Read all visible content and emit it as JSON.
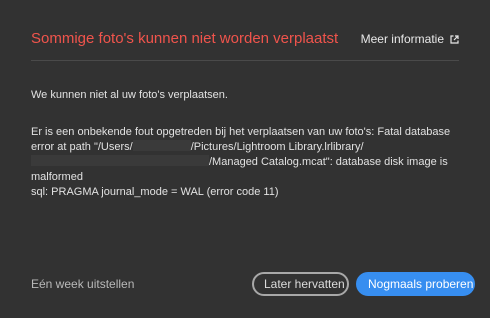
{
  "dialog": {
    "title": "Sommige foto's kunnen niet worden verplaatst",
    "more_info_label": "Meer informatie",
    "more_info_icon": "external-link-icon",
    "intro": "We kunnen niet al uw foto's verplaatsen.",
    "error_lines": {
      "line1": "Er is een onbekende fout opgetreden bij het verplaatsen van uw foto's: Fatal database",
      "line2_start": "error at path \"/Users/",
      "line2_end": "/Pictures/Lightroom Library.lrlibrary/",
      "line3_end": "/Managed Catalog.mcat\": database disk image is",
      "line4": "malformed",
      "line5": "sql: PRAGMA journal_mode = WAL (error code 11)"
    },
    "footer": {
      "postpone_label": "Eén week uitstellen",
      "resume_later_label": "Later hervatten",
      "retry_label": "Nogmaals proberen"
    }
  },
  "colors": {
    "background": "#323232",
    "title": "#f0544c",
    "primary_button": "#378ef0"
  }
}
